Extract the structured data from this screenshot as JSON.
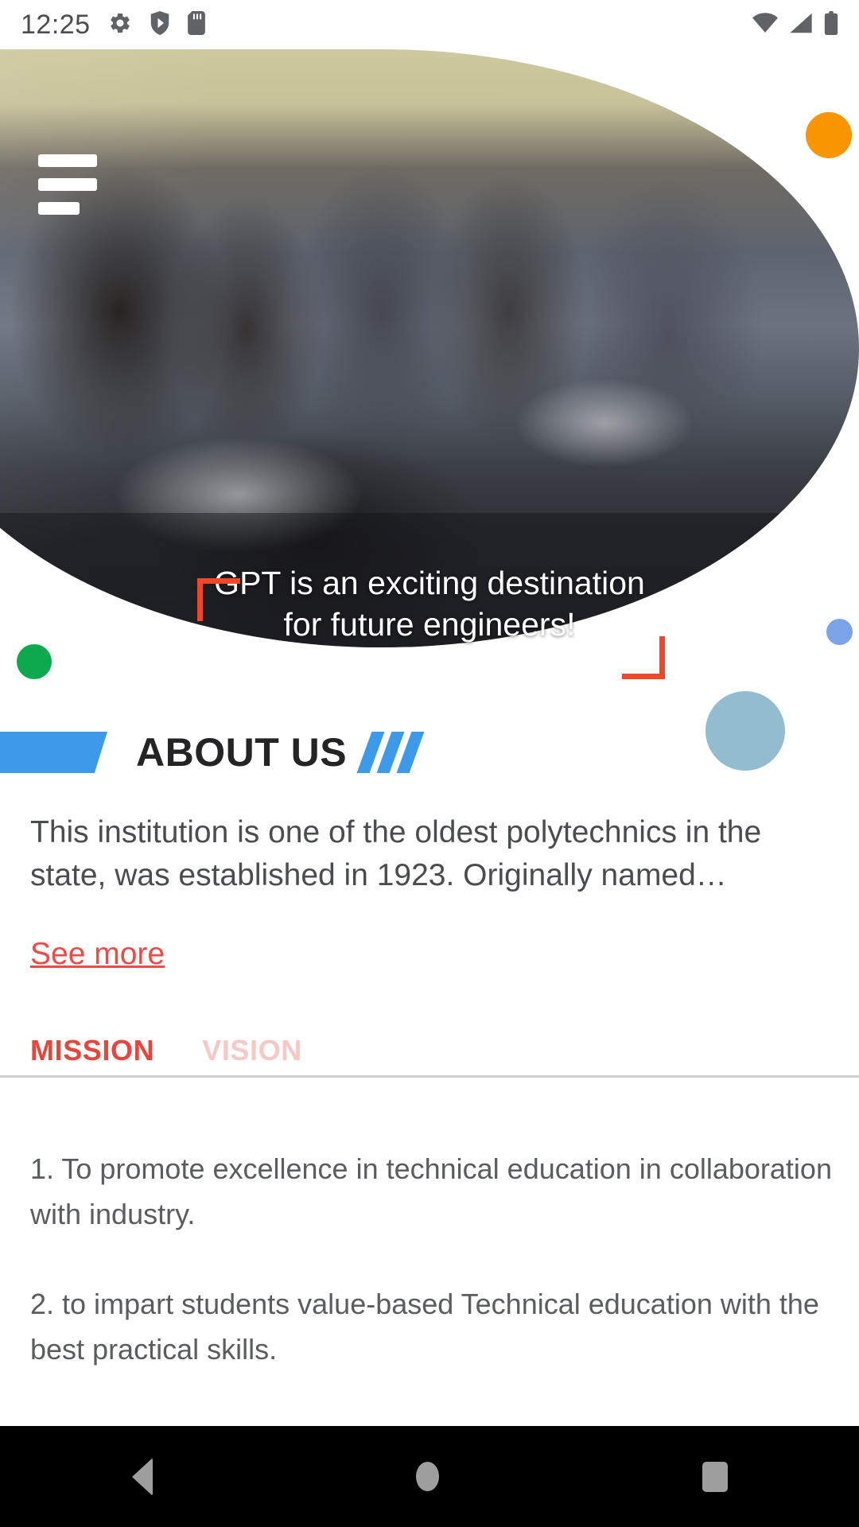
{
  "statusbar": {
    "time": "12:25",
    "left_icons": [
      "gear-icon",
      "shield-play-icon",
      "sd-card-icon"
    ],
    "right_icons": [
      "wifi-icon",
      "cell-signal-icon",
      "battery-icon"
    ]
  },
  "hero": {
    "menu_icon": "hamburger-menu-icon",
    "caption_line1": "GPT is an exciting destination",
    "caption_line2": "for future engineers!",
    "bracket_color": "#f0462a",
    "decorations": [
      {
        "name": "orange-dot",
        "color": "#f99500"
      },
      {
        "name": "green-dot",
        "color": "#0da94e"
      },
      {
        "name": "periwinkle-dot",
        "color": "#7aa3e8"
      },
      {
        "name": "steel-blue-dot",
        "color": "#93bcd0"
      }
    ]
  },
  "about": {
    "title": "ABOUT US",
    "accent_color": "#3d9ae8",
    "paragraph": "This institution is one of the oldest polytechnics in the state, was established in 1923. Originally named…",
    "see_more_label": "See more",
    "see_more_color": "#ef4a45"
  },
  "tabs": {
    "active_color": "#e8453c",
    "inactive_color": "#f6c9c7",
    "items": [
      {
        "label": "MISSION",
        "active": true
      },
      {
        "label": "VISION",
        "active": false
      }
    ]
  },
  "mission": {
    "items": [
      "1. To promote excellence in technical education in collaboration with industry.",
      "2. to impart students value-based Technical education with the best practical skills."
    ]
  },
  "navbar": {
    "back_label": "Back",
    "home_label": "Home",
    "recents_label": "Recents"
  }
}
